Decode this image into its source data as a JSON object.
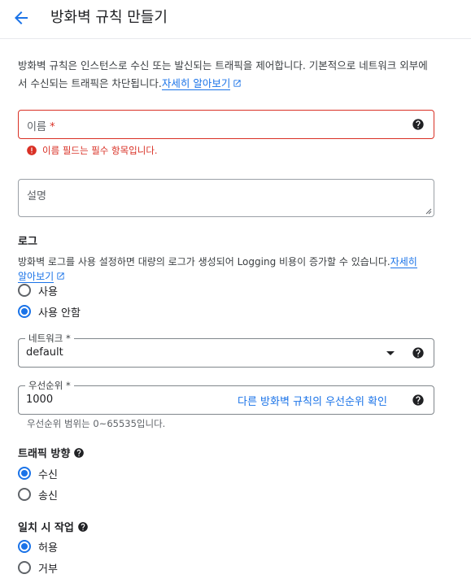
{
  "header": {
    "title": "방화벽 규칙 만들기"
  },
  "intro": {
    "text": "방화벽 규칙은 인스턴스로 수신 또는 발신되는 트래픽을 제어합니다. 기본적으로 네트워크 외부에서 수신되는 트래픽은 차단됩니다.",
    "link": "자세히 알아보기"
  },
  "name_field": {
    "placeholder": "이름",
    "required_mark": "*",
    "error": "이름 필드는 필수 항목입니다."
  },
  "description_field": {
    "placeholder": "설명"
  },
  "logs": {
    "title": "로그",
    "desc": "방화벽 로그를 사용 설정하면 대량의 로그가 생성되어 Logging 비용이 증가할 수 있습니다.",
    "link_part1": "자세히",
    "link_part2": "알아보기",
    "options": [
      "사용",
      "사용 안함"
    ],
    "selected": "사용 안함"
  },
  "network": {
    "label": "네트워크 *",
    "value": "default"
  },
  "priority": {
    "label": "우선순위 *",
    "value": "1000",
    "link": "다른 방화벽 규칙의 우선순위 확인",
    "hint": "우선순위 범위는 0~65535입니다."
  },
  "direction": {
    "title": "트래픽 방향",
    "options": [
      "수신",
      "송신"
    ],
    "selected": "수신"
  },
  "action": {
    "title": "일치 시 작업",
    "options": [
      "허용",
      "거부"
    ],
    "selected": "허용"
  },
  "colors": {
    "accent": "#1a73e8",
    "error": "#d93025"
  }
}
